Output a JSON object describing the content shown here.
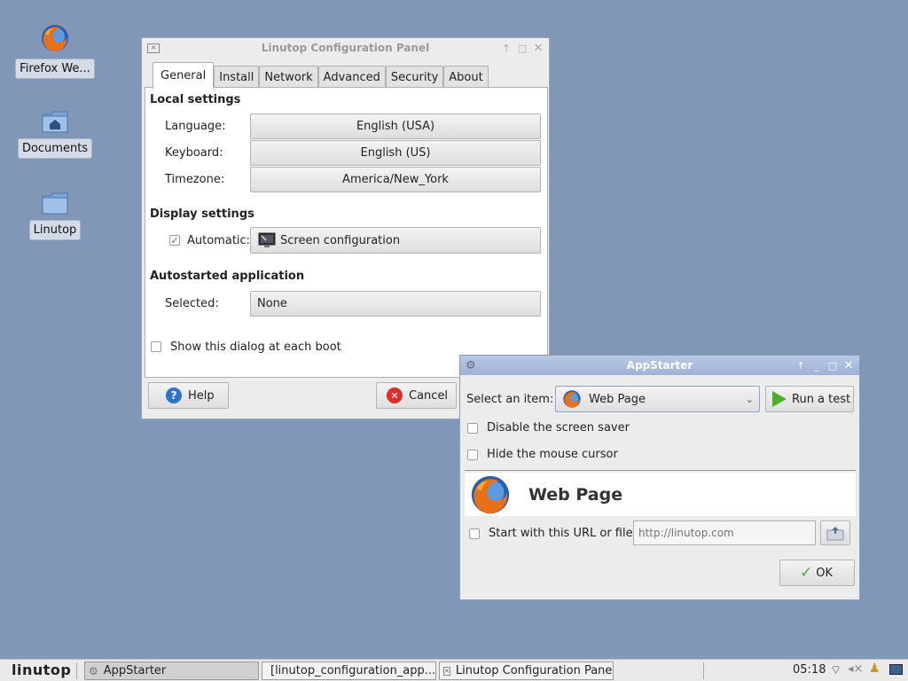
{
  "desktop": {
    "icons": [
      {
        "label": "Firefox We...",
        "icon": "firefox-icon"
      },
      {
        "label": "Documents",
        "icon": "home-folder-icon"
      },
      {
        "label": "Linutop",
        "icon": "folder-icon"
      }
    ]
  },
  "config_panel": {
    "title": "Linutop Configuration Panel",
    "tabs": [
      "General",
      "Install",
      "Network",
      "Advanced",
      "Security",
      "About"
    ],
    "active_tab": "General",
    "local_settings": {
      "heading": "Local settings",
      "language_label": "Language:",
      "language_value": "English (USA)",
      "keyboard_label": "Keyboard:",
      "keyboard_value": "English (US)",
      "timezone_label": "Timezone:",
      "timezone_value": "America/New_York"
    },
    "display_settings": {
      "heading": "Display settings",
      "automatic_label": "Automatic:",
      "automatic_checked": true,
      "screen_button": "Screen configuration"
    },
    "autostart": {
      "heading": "Autostarted application",
      "selected_label": "Selected:",
      "selected_value": "None"
    },
    "show_dialog_label": "Show this dialog at each boot",
    "help_button": "Help",
    "cancel_button": "Cancel"
  },
  "appstarter": {
    "title": "AppStarter",
    "select_label": "Select an item:",
    "selected_item": "Web Page",
    "run_test_button": "Run a test",
    "disable_screensaver_label": "Disable the screen saver",
    "hide_cursor_label": "Hide the mouse cursor",
    "header_title": "Web Page",
    "start_url_label": "Start with this URL or file:",
    "url_placeholder": "http://linutop.com",
    "ok_button": "OK"
  },
  "taskbar": {
    "logo": "linutop",
    "tasks": [
      "AppStarter",
      "[linutop_configuration_app...",
      "Linutop Configuration Panel"
    ],
    "clock": "05:18"
  },
  "colors": {
    "desktop": "#8197b8",
    "titlebar_active": "#9fb3d6",
    "cancel_red": "#d9302b",
    "help_blue": "#2f73c9",
    "ok_green": "#4caf2a"
  }
}
